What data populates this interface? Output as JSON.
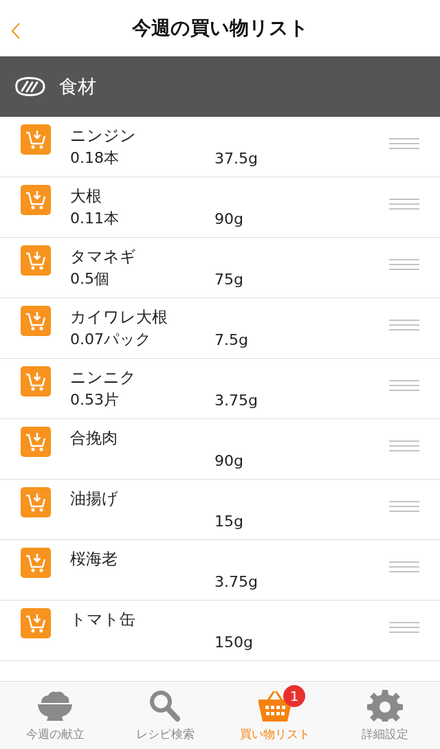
{
  "header": {
    "title": "今週の買い物リスト"
  },
  "section": {
    "title": "食材"
  },
  "items": [
    {
      "name": "ニンジン",
      "amount": "0.18本",
      "weight": "37.5g"
    },
    {
      "name": "大根",
      "amount": "0.11本",
      "weight": "90g"
    },
    {
      "name": "タマネギ",
      "amount": "0.5個",
      "weight": "75g"
    },
    {
      "name": "カイワレ大根",
      "amount": "0.07パック",
      "weight": "7.5g"
    },
    {
      "name": "ニンニク",
      "amount": "0.53片",
      "weight": "3.75g"
    },
    {
      "name": "合挽肉",
      "weight": "90g"
    },
    {
      "name": "油揚げ",
      "weight": "15g"
    },
    {
      "name": "桜海老",
      "weight": "3.75g"
    },
    {
      "name": "トマト缶",
      "weight": "150g"
    }
  ],
  "tabs": [
    {
      "kind": "rice",
      "label": "今週の献立",
      "selected": false
    },
    {
      "kind": "search",
      "label": "レシピ検索",
      "selected": false
    },
    {
      "kind": "basket",
      "label": "買い物リスト",
      "selected": true,
      "badge": "1"
    },
    {
      "kind": "settings",
      "label": "詳細設定",
      "selected": false
    }
  ]
}
